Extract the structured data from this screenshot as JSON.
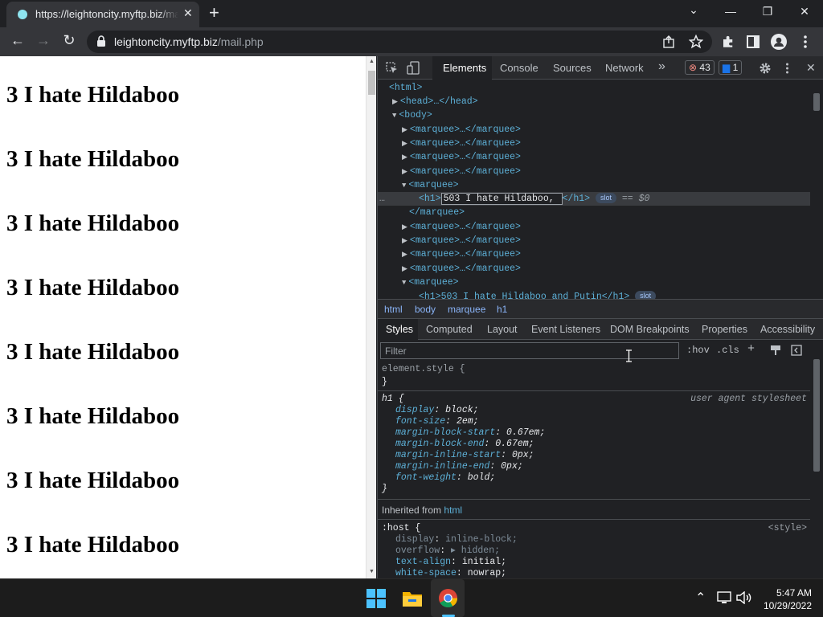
{
  "browser": {
    "tab_title": "https://leightoncity.myftp.biz/mail.php",
    "tab_close": "✕",
    "new_tab": "+",
    "window_controls": {
      "chevron": "⌄",
      "minimize": "—",
      "restore": "❐",
      "close": "✕"
    },
    "nav": {
      "back": "←",
      "forward": "→",
      "reload": "↻"
    },
    "url_host": "leightoncity.myftp.biz",
    "url_path": "/mail.php",
    "toolbar_icons": [
      "share-icon",
      "star-icon",
      "extensions-icon",
      "sidepanel-icon",
      "profile-icon",
      "menu-icon"
    ]
  },
  "page": {
    "headings": [
      "3 I hate Hildaboo",
      "3 I hate Hildaboo",
      "3 I hate Hildaboo",
      "3 I hate Hildaboo",
      "3 I hate Hildaboo",
      "3 I hate Hildaboo",
      "3 I hate Hildaboo",
      "3 I hate Hildaboo"
    ]
  },
  "devtools": {
    "tabs": [
      "Elements",
      "Console",
      "Sources",
      "Network"
    ],
    "more_tabs": "»",
    "errors_count": "43",
    "messages_count": "1",
    "dom": {
      "html_open": "<html>",
      "head_collapsed": "<head>…</head>",
      "body_open": "<body>",
      "marquee_collapsed": "<marquee>…</marquee>",
      "marquee_open": "<marquee>",
      "marquee_close": "</marquee>",
      "selected_h1_open": "<h1>",
      "selected_h1_text": "503 I hate Hildaboo, ",
      "selected_h1_close": "</h1>",
      "slot_label": "slot",
      "eq_label": "== $0",
      "next_h1": "<h1>503 I hate Hildaboo and Putin</h1>",
      "row_dots": "…"
    },
    "breadcrumbs": [
      "html",
      "body",
      "marquee",
      "h1"
    ],
    "subtabs": [
      "Styles",
      "Computed",
      "Layout",
      "Event Listeners",
      "DOM Breakpoints",
      "Properties",
      "Accessibility"
    ],
    "filter_placeholder": "Filter",
    "filter_tools": {
      "hov": ":hov",
      "cls": ".cls",
      "plus": "+"
    },
    "styles": {
      "element_style": "element.style {",
      "close_brace": "}",
      "h1_selector": "h1 {",
      "h1_source": "user agent stylesheet",
      "h1_props": [
        {
          "name": "display",
          "value": "block;"
        },
        {
          "name": "font-size",
          "value": "2em;"
        },
        {
          "name": "margin-block-start",
          "value": "0.67em;"
        },
        {
          "name": "margin-block-end",
          "value": "0.67em;"
        },
        {
          "name": "margin-inline-start",
          "value": "0px;"
        },
        {
          "name": "margin-inline-end",
          "value": "0px;"
        },
        {
          "name": "font-weight",
          "value": "bold;"
        }
      ],
      "inherited_label": "Inherited from",
      "inherited_from": "html",
      "host_selector": ":host {",
      "host_source": "<style>",
      "host_props": [
        {
          "name": "display",
          "value": "inline-block;",
          "dim": true
        },
        {
          "name": "overflow",
          "value": "▸ hidden;",
          "dim": true
        },
        {
          "name": "text-align",
          "value": "initial;",
          "dim": false
        },
        {
          "name": "white-space",
          "value": "nowrap;",
          "dim": false
        }
      ]
    }
  },
  "taskbar": {
    "time": "5:47 AM",
    "date": "10/29/2022",
    "tray_chevron": "⌃",
    "apps": [
      "windows-start-icon",
      "file-explorer-icon",
      "chrome-icon"
    ]
  },
  "colors": {
    "chrome_dark": "#202124",
    "chrome_toolbar": "#35363a",
    "devtools_tag": "#5db0d7",
    "link_blue": "#8ab4f8",
    "error_red": "#f28b82",
    "info_blue": "#1a73e8"
  }
}
